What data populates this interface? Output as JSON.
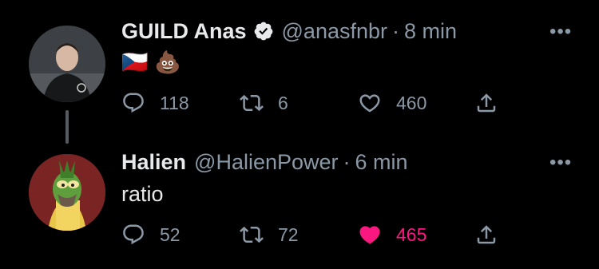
{
  "tweets": [
    {
      "name": "GUILD Anas",
      "handle": "@anasfnbr",
      "separator": "·",
      "time": "8 min",
      "more": "•••",
      "content": "🇨🇿 💩",
      "counts": {
        "replies": "118",
        "retweets": "6",
        "likes": "460"
      },
      "liked": false,
      "verified": true
    },
    {
      "name": "Halien",
      "handle": "@HalienPower",
      "separator": "·",
      "time": "6 min",
      "more": "•••",
      "content": "ratio",
      "counts": {
        "replies": "52",
        "retweets": "72",
        "likes": "465"
      },
      "liked": true,
      "verified": false
    }
  ],
  "colors": {
    "like_active": "#f91880",
    "secondary": "#8b98a5",
    "verified": "#e7e9ea"
  }
}
